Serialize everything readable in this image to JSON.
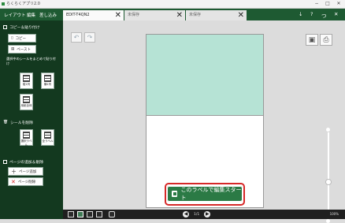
{
  "window": {
    "title": "らくらくアプリ2.0",
    "controls": [
      "−",
      "□",
      "✕"
    ]
  },
  "menu": {
    "items": [
      "レイアウト",
      "編集",
      "差し込み"
    ]
  },
  "tabs": [
    {
      "label": "EDIT-T4QN2",
      "close": "✕"
    },
    {
      "label": "未保存",
      "close": "✕"
    },
    {
      "label": "未保存",
      "close": "✕"
    }
  ],
  "tabbar_right": {
    "icons": [
      "↓",
      "?",
      "つ",
      "✕"
    ]
  },
  "sidebar": {
    "copy_section": "コピー＆貼り付け",
    "copy": "コピー",
    "paste": "ペースト",
    "note": "選択中のシールをまとめて貼り付け",
    "tiles1": [
      "縦1列",
      "横1列",
      "用紙全体"
    ],
    "label_section": "シールを削除",
    "tiles2": [
      "選択ラベル",
      "全ラベル"
    ],
    "page_section": "ページの追加＆削除",
    "add_page": "ページ追加",
    "del_page": "ページ削除"
  },
  "canvas": {
    "start_button": "このラベルで編集スタート",
    "undo_icon": "undo-icon",
    "redo_icon": "redo-icon"
  },
  "bottombar": {
    "page_indicator": "1/1",
    "zoom": "100%"
  },
  "colors": {
    "accent": "#1e5a32",
    "sidebar": "#13391f",
    "label_fill": "#b6e3d5",
    "highlight": "#d62828"
  }
}
